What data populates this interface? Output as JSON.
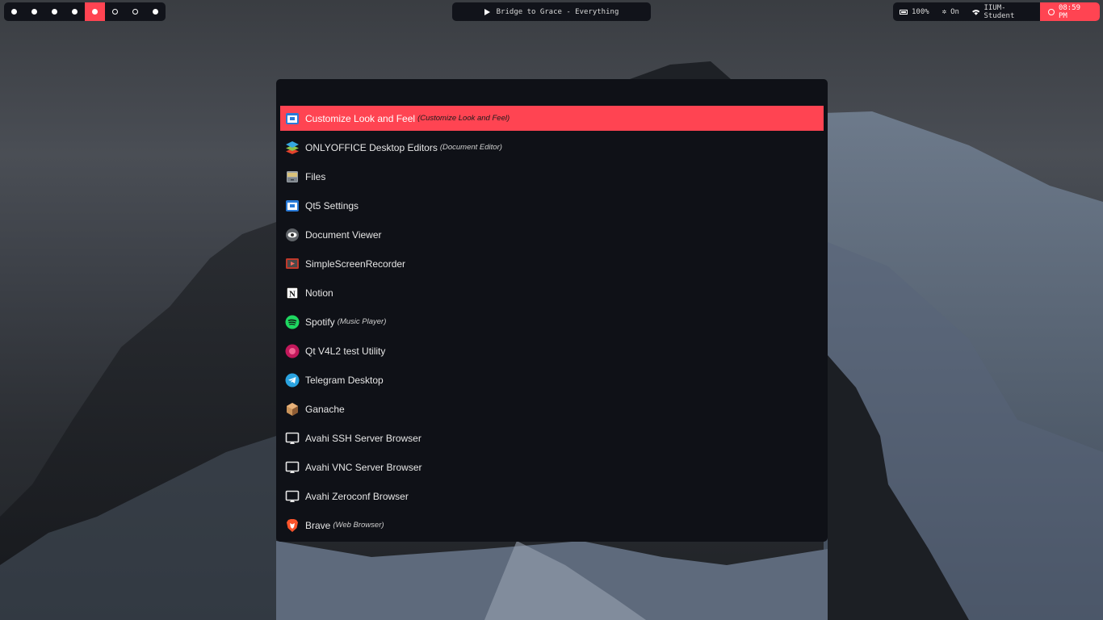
{
  "workspaces": [
    {
      "state": "occupied"
    },
    {
      "state": "occupied"
    },
    {
      "state": "occupied"
    },
    {
      "state": "occupied"
    },
    {
      "state": "active"
    },
    {
      "state": "empty"
    },
    {
      "state": "empty"
    },
    {
      "state": "occupied"
    }
  ],
  "media": {
    "icon": "play-icon",
    "title": "Bridge to Grace - Everything"
  },
  "status": {
    "battery": "100%",
    "bluetooth": "On",
    "wifi": "IIUM-Student",
    "clock": "08:59 PM"
  },
  "colors": {
    "accent": "#ff4452",
    "panel": "#0f1117",
    "bar": "#11131a"
  },
  "launcher": {
    "query": "",
    "entries": [
      {
        "name": "Customize Look and Feel",
        "generic": "(Customize Look and Feel)",
        "icon": "window-settings-icon",
        "selected": true
      },
      {
        "name": "ONLYOFFICE Desktop Editors",
        "generic": "(Document Editor)",
        "icon": "onlyoffice-icon"
      },
      {
        "name": "Files",
        "generic": "",
        "icon": "file-cabinet-icon"
      },
      {
        "name": "Qt5 Settings",
        "generic": "",
        "icon": "window-settings-icon"
      },
      {
        "name": "Document Viewer",
        "generic": "",
        "icon": "eye-icon"
      },
      {
        "name": "SimpleScreenRecorder",
        "generic": "",
        "icon": "screen-recorder-icon"
      },
      {
        "name": "Notion",
        "generic": "",
        "icon": "notion-icon"
      },
      {
        "name": "Spotify",
        "generic": "(Music Player)",
        "icon": "spotify-icon"
      },
      {
        "name": "Qt V4L2 test Utility",
        "generic": "",
        "icon": "webcam-icon"
      },
      {
        "name": "Telegram Desktop",
        "generic": "",
        "icon": "telegram-icon"
      },
      {
        "name": "Ganache",
        "generic": "",
        "icon": "ganache-icon"
      },
      {
        "name": "Avahi SSH Server Browser",
        "generic": "",
        "icon": "monitor-icon"
      },
      {
        "name": "Avahi VNC Server Browser",
        "generic": "",
        "icon": "monitor-icon"
      },
      {
        "name": "Avahi Zeroconf Browser",
        "generic": "",
        "icon": "monitor-icon"
      },
      {
        "name": "Brave",
        "generic": "(Web Browser)",
        "icon": "brave-icon"
      }
    ]
  }
}
